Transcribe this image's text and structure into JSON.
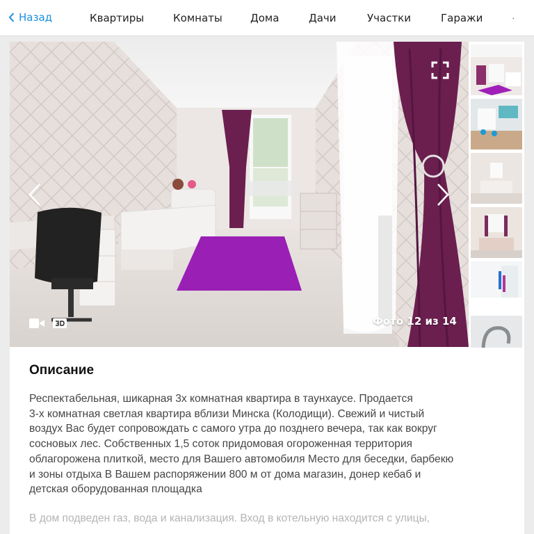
{
  "nav": {
    "back_label": "Назад",
    "categories": [
      "Квартиры",
      "Комнаты",
      "Дома",
      "Дачи",
      "Участки",
      "Гаражи"
    ],
    "more_glyph": "·"
  },
  "gallery": {
    "counter": "Фото 12 из 14",
    "thumbnail_count": 6,
    "colors": {
      "accent": "#1a8fe0",
      "curtain": "#6b1f4f",
      "rug": "#9a1fb5"
    }
  },
  "description": {
    "heading": "Описание",
    "lines": [
      "Респектабельная, шикарная 3х комнатная квартира в таунхаусе.  Продается",
      "3-х комнатная светлая квартира вблизи Минска (Колодищи).  Свежий и чистый",
      "воздух Вас будет сопровождать с самого утра до позднего вечера, так как вокруг",
      "сосновых лес.  Собственных 1,5 соток придомовая огороженная территория",
      "облагорожена плиткой, место для Вашего автомобиля  Место для беседки, барбекю",
      "и зоны отдыха  В Вашем распоряжении 800 м от дома магазин, донер кебаб и",
      "детская оборудованная площадка"
    ],
    "faded_line": "В дом подведен газ, вода и канализация. Вход в котельную находится с улицы,"
  },
  "icons": [
    "chevron-left-icon",
    "fullscreen-icon",
    "video-icon",
    "3d-icon",
    "arrow-left-icon",
    "arrow-right-icon"
  ]
}
